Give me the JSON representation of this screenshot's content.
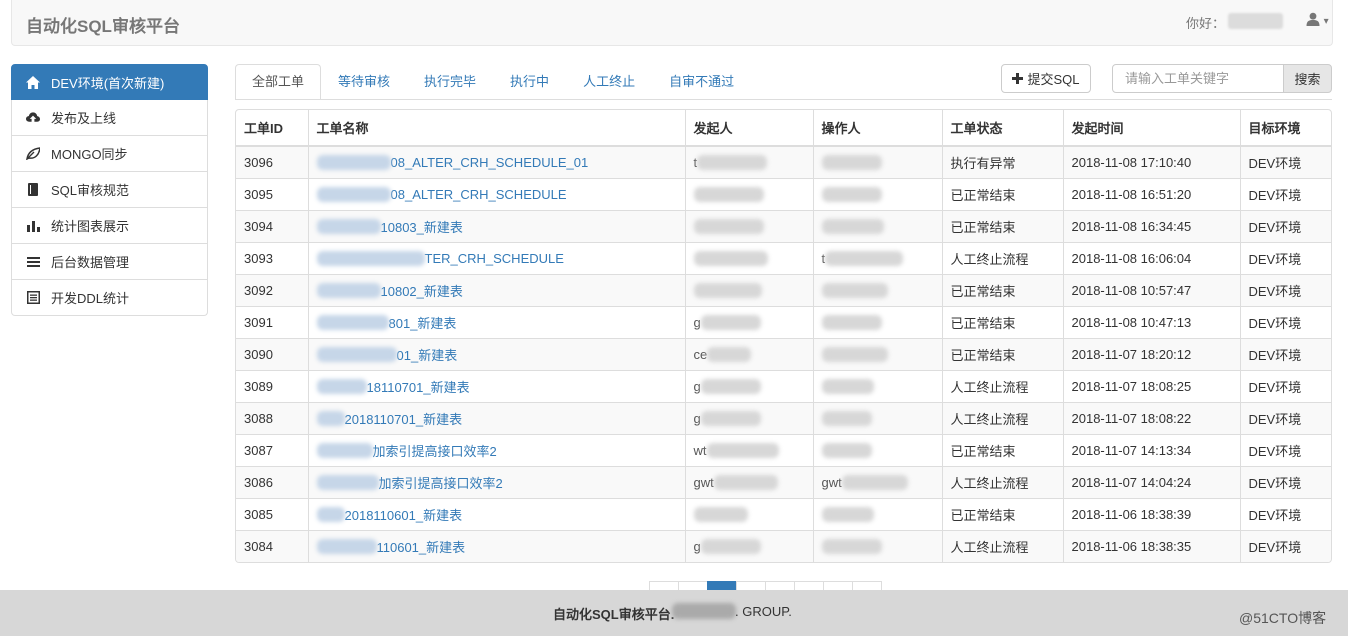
{
  "header": {
    "brand": "自动化SQL审核平台",
    "greeting": "你好：",
    "user_menu_caret": "▾"
  },
  "sidebar": {
    "items": [
      {
        "label": "DEV环境(首次新建)",
        "icon": "home-icon",
        "active": true
      },
      {
        "label": "发布及上线",
        "icon": "cloud-upload-icon",
        "active": false
      },
      {
        "label": "MONGO同步",
        "icon": "leaf-icon",
        "active": false
      },
      {
        "label": "SQL审核规范",
        "icon": "book-icon",
        "active": false
      },
      {
        "label": "统计图表展示",
        "icon": "bar-chart-icon",
        "active": false
      },
      {
        "label": "后台数据管理",
        "icon": "list-icon",
        "active": false
      },
      {
        "label": "开发DDL统计",
        "icon": "list-alt-icon",
        "active": false
      }
    ]
  },
  "tabs": [
    {
      "label": "全部工单",
      "active": true
    },
    {
      "label": "等待审核",
      "active": false
    },
    {
      "label": "执行完毕",
      "active": false
    },
    {
      "label": "执行中",
      "active": false
    },
    {
      "label": "人工终止",
      "active": false
    },
    {
      "label": "自审不通过",
      "active": false
    }
  ],
  "toolbar": {
    "submit_label": "提交SQL",
    "search_placeholder": "请输入工单关键字",
    "search_label": "搜索"
  },
  "table": {
    "columns": [
      "工单ID",
      "工单名称",
      "发起人",
      "操作人",
      "工单状态",
      "发起时间",
      "目标环境"
    ],
    "rows": [
      {
        "id": "3096",
        "name": "08_ALTER_CRH_SCHEDULE_01",
        "name_blur": 74,
        "initiator": "t",
        "initiator_blur": 70,
        "operator": "",
        "operator_blur": 60,
        "status": "执行有异常",
        "time": "2018-11-08 17:10:40",
        "env": "DEV环境"
      },
      {
        "id": "3095",
        "name": "08_ALTER_CRH_SCHEDULE",
        "name_blur": 74,
        "initiator": "",
        "initiator_blur": 70,
        "operator": "",
        "operator_blur": 60,
        "status": "已正常结束",
        "time": "2018-11-08 16:51:20",
        "env": "DEV环境"
      },
      {
        "id": "3094",
        "name": "10803_新建表",
        "name_blur": 64,
        "initiator": "",
        "initiator_blur": 70,
        "operator": "",
        "operator_blur": 62,
        "status": "已正常结束",
        "time": "2018-11-08 16:34:45",
        "env": "DEV环境"
      },
      {
        "id": "3093",
        "name": "TER_CRH_SCHEDULE",
        "name_blur": 108,
        "initiator": "",
        "initiator_blur": 74,
        "operator": "t",
        "operator_blur": 78,
        "status": "人工终止流程",
        "time": "2018-11-08 16:06:04",
        "env": "DEV环境"
      },
      {
        "id": "3092",
        "name": "10802_新建表",
        "name_blur": 64,
        "initiator": "",
        "initiator_blur": 68,
        "operator": "",
        "operator_blur": 66,
        "status": "已正常结束",
        "time": "2018-11-08 10:57:47",
        "env": "DEV环境"
      },
      {
        "id": "3091",
        "name": "801_新建表",
        "name_blur": 72,
        "initiator": "g",
        "initiator_blur": 60,
        "operator": "",
        "operator_blur": 60,
        "status": "已正常结束",
        "time": "2018-11-08 10:47:13",
        "env": "DEV环境"
      },
      {
        "id": "3090",
        "name": "01_新建表",
        "name_blur": 80,
        "initiator": "ce",
        "initiator_blur": 44,
        "operator": "",
        "operator_blur": 66,
        "status": "已正常结束",
        "time": "2018-11-07 18:20:12",
        "env": "DEV环境"
      },
      {
        "id": "3089",
        "name": "18110701_新建表",
        "name_blur": 50,
        "initiator": "g",
        "initiator_blur": 60,
        "operator": "",
        "operator_blur": 52,
        "status": "人工终止流程",
        "time": "2018-11-07 18:08:25",
        "env": "DEV环境"
      },
      {
        "id": "3088",
        "name": "2018110701_新建表",
        "name_blur": 28,
        "initiator": "g",
        "initiator_blur": 60,
        "operator": "",
        "operator_blur": 50,
        "status": "人工终止流程",
        "time": "2018-11-07 18:08:22",
        "env": "DEV环境"
      },
      {
        "id": "3087",
        "name": "加索引提高接口效率2",
        "name_blur": 56,
        "initiator": "wt",
        "initiator_blur": 72,
        "operator": "",
        "operator_blur": 50,
        "status": "已正常结束",
        "time": "2018-11-07 14:13:34",
        "env": "DEV环境"
      },
      {
        "id": "3086",
        "name": "加索引提高接口效率2",
        "name_blur": 62,
        "initiator": "gwt",
        "initiator_blur": 64,
        "operator": "gwt",
        "operator_blur": 66,
        "status": "人工终止流程",
        "time": "2018-11-07 14:04:24",
        "env": "DEV环境"
      },
      {
        "id": "3085",
        "name": "2018110601_新建表",
        "name_blur": 28,
        "initiator": "",
        "initiator_blur": 54,
        "operator": "",
        "operator_blur": 52,
        "status": "已正常结束",
        "time": "2018-11-06 18:38:39",
        "env": "DEV环境"
      },
      {
        "id": "3084",
        "name": "110601_新建表",
        "name_blur": 60,
        "initiator": "g",
        "initiator_blur": 60,
        "operator": "",
        "operator_blur": 60,
        "status": "人工终止流程",
        "time": "2018-11-06 18:38:35",
        "env": "DEV环境"
      }
    ]
  },
  "pagination": {
    "pages": 8,
    "active_index": 2
  },
  "footer": {
    "text": "自动化SQL审核平台.",
    "group": ". GROUP."
  },
  "watermark": "@51CTO博客",
  "colors": {
    "primary": "#337ab7",
    "footer_bg": "#d7d7d7"
  }
}
